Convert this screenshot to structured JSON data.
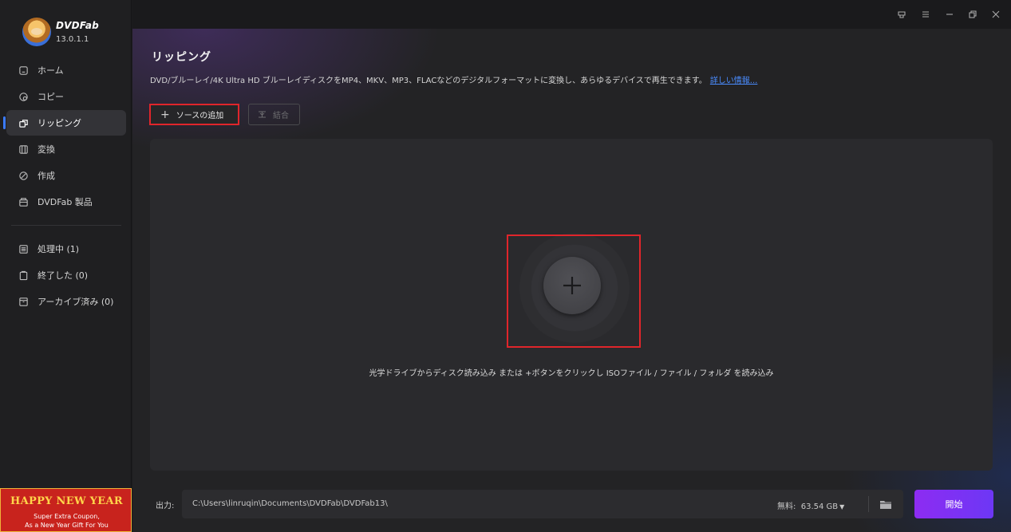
{
  "app": {
    "name": "DVDFab",
    "version": "13.0.1.1"
  },
  "sidebar": {
    "items": [
      {
        "label": "ホーム",
        "icon": "home-icon"
      },
      {
        "label": "コピー",
        "icon": "copy-icon"
      },
      {
        "label": "リッピング",
        "icon": "ripper-icon",
        "active": true
      },
      {
        "label": "変換",
        "icon": "convert-icon"
      },
      {
        "label": "作成",
        "icon": "creator-icon"
      },
      {
        "label": "DVDFab 製品",
        "icon": "products-icon"
      }
    ],
    "queue": [
      {
        "label": "処理中 (1)",
        "icon": "processing-icon"
      },
      {
        "label": "終了した (0)",
        "icon": "finished-icon"
      },
      {
        "label": "アーカイブ済み (0)",
        "icon": "archive-icon"
      }
    ],
    "promo": {
      "title": "HAPPY NEW YEAR",
      "line1": "Super Extra Coupon,",
      "line2": "As a New Year Gift For You"
    }
  },
  "main": {
    "title": "リッピング",
    "description": "DVD/ブルーレイ/4K Ultra HD ブルーレイディスクをMP4、MKV、MP3、FLACなどのデジタルフォーマットに変換し、あらゆるデバイスで再生できます。",
    "more_link": "詳しい情報...",
    "add_source_label": "ソースの追加",
    "merge_label": "結合",
    "drop_hint": "光学ドライブからディスク読み込み または +ボタンをクリックし ISOファイル / ファイル / フォルダ を読み込み"
  },
  "output": {
    "label": "出力:",
    "path": "C:\\Users\\linruqin\\Documents\\DVDFab\\DVDFab13\\",
    "free_label": "無料:",
    "free_value": "63.54 GB",
    "start_label": "開始"
  },
  "colors": {
    "accent": "#3b7bff",
    "highlight": "#e0252b",
    "start_button": "#8d2cf2",
    "link": "#4a8cff"
  }
}
